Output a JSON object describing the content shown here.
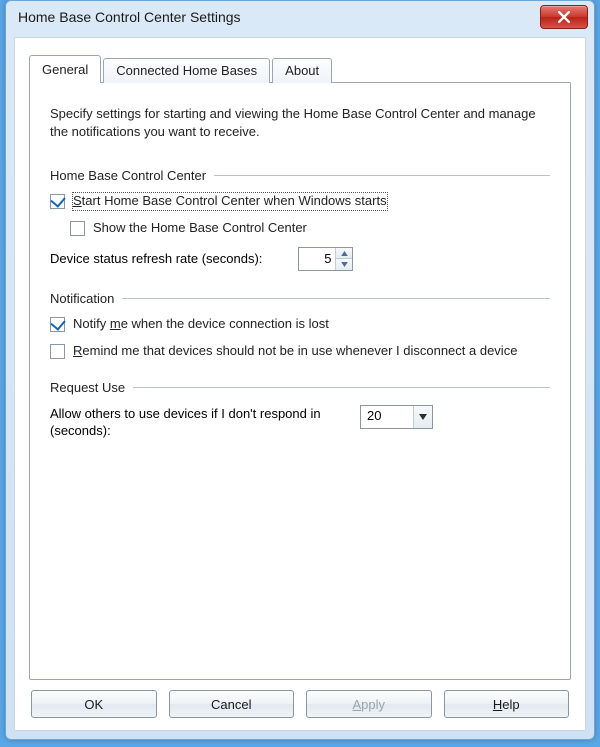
{
  "window": {
    "title": "Home Base Control Center Settings"
  },
  "tabs": {
    "general": "General",
    "connected": "Connected Home Bases",
    "about": "About",
    "active": "general"
  },
  "intro": "Specify settings for starting and viewing the Home Base Control Center and manage the notifications you want to receive.",
  "groups": {
    "hbcc": {
      "title": "Home Base Control Center",
      "start_label_pre": "S",
      "start_label_rest": "tart Home Base Control Center when Windows starts",
      "start_checked": true,
      "show_label": "Show the Home Base Control Center",
      "show_checked": false,
      "refresh_label": "Device status refresh rate (seconds):",
      "refresh_value": "5"
    },
    "notification": {
      "title": "Notification",
      "notify_label_pre": "Notify ",
      "notify_label_ul": "m",
      "notify_label_post": "e when the device connection is lost",
      "notify_checked": true,
      "remind_label_ul": "R",
      "remind_label_post": "emind me that devices should not be in use whenever I disconnect a device",
      "remind_checked": false
    },
    "request": {
      "title": "Request Use",
      "label_pre": "Allow others to use ",
      "label_ul": "d",
      "label_post": "evices if I don't respond in (seconds):",
      "value": "20"
    }
  },
  "buttons": {
    "ok": "OK",
    "cancel": "Cancel",
    "apply_ul": "A",
    "apply_rest": "pply",
    "help_ul": "H",
    "help_rest": "elp"
  }
}
